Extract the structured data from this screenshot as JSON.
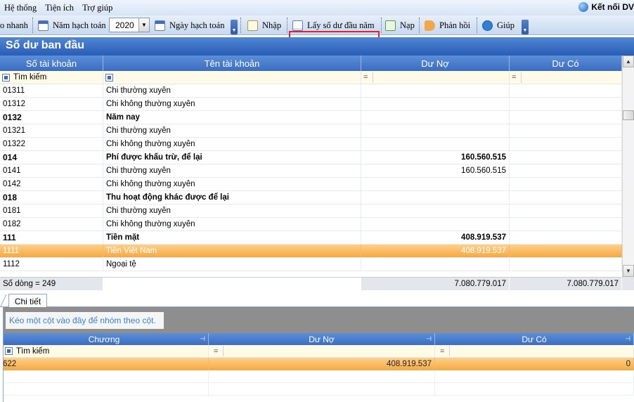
{
  "menu": {
    "items": [
      "Hệ thống",
      "Tiện ích",
      "Trợ giúp"
    ],
    "connect_label": "Kết nối DV"
  },
  "toolbar": {
    "quick_label": "o nhanh",
    "year_label": "Năm hạch toán",
    "year_value": "2020",
    "date_label": "Ngày hạch toán",
    "import_label": "Nhập",
    "get_balance_label": "Lấy số dư đầu năm",
    "load_label": "Nạp",
    "feedback_label": "Phản hồi",
    "help_label": "Giúp"
  },
  "panel": {
    "title": "Số dư ban đầu"
  },
  "grid": {
    "columns": [
      "Số tài khoản",
      "Tên tài khoản",
      "Dư Nợ",
      "Dư Có"
    ],
    "search_label": "Tìm kiếm",
    "rows": [
      {
        "code": "01311",
        "name": "Chi thường xuyên",
        "debit": "",
        "credit": "",
        "bold": false,
        "selected": false
      },
      {
        "code": "01312",
        "name": "Chi không thường xuyên",
        "debit": "",
        "credit": "",
        "bold": false,
        "selected": false
      },
      {
        "code": "0132",
        "name": "Năm nay",
        "debit": "",
        "credit": "",
        "bold": true,
        "selected": false
      },
      {
        "code": "01321",
        "name": "Chi thường xuyên",
        "debit": "",
        "credit": "",
        "bold": false,
        "selected": false
      },
      {
        "code": "01322",
        "name": "Chi không thường xuyên",
        "debit": "",
        "credit": "",
        "bold": false,
        "selected": false
      },
      {
        "code": "014",
        "name": "Phí được khấu trừ, để lại",
        "debit": "160.560.515",
        "credit": "",
        "bold": true,
        "selected": false
      },
      {
        "code": "0141",
        "name": "Chi thường xuyên",
        "debit": "160.560.515",
        "credit": "",
        "bold": false,
        "selected": false
      },
      {
        "code": "0142",
        "name": "Chi không thường xuyên",
        "debit": "",
        "credit": "",
        "bold": false,
        "selected": false
      },
      {
        "code": "018",
        "name": "Thu hoạt động khác được để lại",
        "debit": "",
        "credit": "",
        "bold": true,
        "selected": false
      },
      {
        "code": "0181",
        "name": "Chi thường xuyên",
        "debit": "",
        "credit": "",
        "bold": false,
        "selected": false
      },
      {
        "code": "0182",
        "name": "Chi không thường xuyên",
        "debit": "",
        "credit": "",
        "bold": false,
        "selected": false
      },
      {
        "code": "111",
        "name": "Tiền mặt",
        "debit": "408.919.537",
        "credit": "",
        "bold": true,
        "selected": false
      },
      {
        "code": "1111",
        "name": "Tiền Việt Nam",
        "debit": "408.919.537",
        "credit": "",
        "bold": false,
        "selected": true
      },
      {
        "code": "1112",
        "name": "Ngoại tệ",
        "debit": "",
        "credit": "",
        "bold": false,
        "selected": false
      }
    ],
    "footer": {
      "row_count": "Số dòng = 249",
      "debit_total": "7.080.779.017",
      "credit_total": "7.080.779.017"
    }
  },
  "detail": {
    "tab_label": "Chi tiết",
    "group_hint": "Kéo một cột vào đây để nhóm theo cột.",
    "columns": [
      "Chương",
      "Dư Nợ",
      "Dư Có"
    ],
    "search_label": "Tìm kiếm",
    "rows": [
      {
        "chapter": "622",
        "debit": "408.919.537",
        "credit": "0"
      }
    ]
  }
}
